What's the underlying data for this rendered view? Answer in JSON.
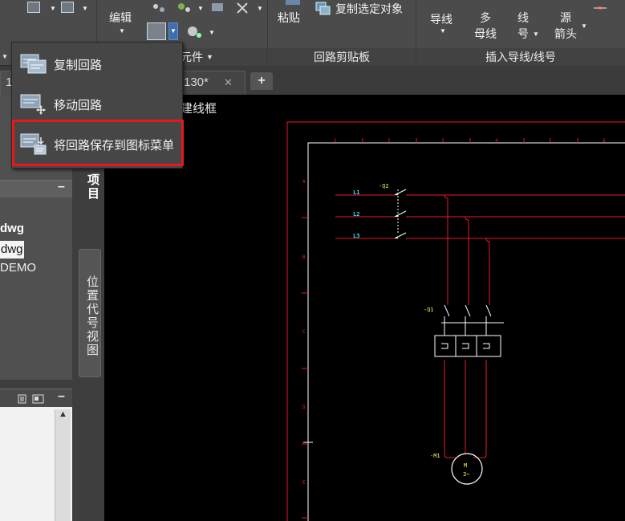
{
  "ribbon": {
    "edit_label": "编辑",
    "components_panel_label": "元件",
    "paste_label": "粘贴",
    "copy_selected_label": "复制选定对象",
    "clipboard_panel_label": "回路剪贴板",
    "wire_label": "导线",
    "multi_wire_label": [
      "多",
      "母线"
    ],
    "wire_number_label": [
      "线",
      "号"
    ],
    "source_arrow_label": [
      "源",
      "箭头"
    ],
    "insert_panel_label": "插入导线/线号"
  },
  "tabs": {
    "first_tab": "1",
    "active_tab": "130*",
    "new_tab": "+"
  },
  "menu": {
    "items": [
      {
        "label": "复制回路",
        "icon": "copy-circuit-icon"
      },
      {
        "label": "移动回路",
        "icon": "move-circuit-icon"
      },
      {
        "label": "将回路保存到图标菜单",
        "icon": "save-circuit-to-icon-menu-icon"
      }
    ],
    "highlight_color": "#e8171b"
  },
  "project_panel": {
    "lines": [
      "dwg",
      "dwg",
      "DEMO"
    ],
    "vertical_tab_project": "项目",
    "vertical_tab_location": "位置代号视图"
  },
  "canvas": {
    "label_fragment": "建线框"
  },
  "drawing": {
    "line_labels": [
      "L1",
      "L2",
      "L3"
    ],
    "breaker_tag": "-Q2",
    "contactor_tag": "-Q1",
    "motor_tag": "-M1",
    "motor_text": [
      "M",
      "3~"
    ],
    "row_letters": [
      "A",
      "B",
      "C",
      "D",
      "E"
    ],
    "col_numbers": [
      "1",
      "2",
      "3",
      "4",
      "5",
      "6"
    ]
  },
  "colors": {
    "ribbon_bg": "#4b4b4b",
    "canvas_bg": "#000000",
    "wire_red": "#e8192a",
    "symbol_white": "#ffffff",
    "label_cyan": "#2ee6ff",
    "tag_yellow": "#f5f050"
  }
}
